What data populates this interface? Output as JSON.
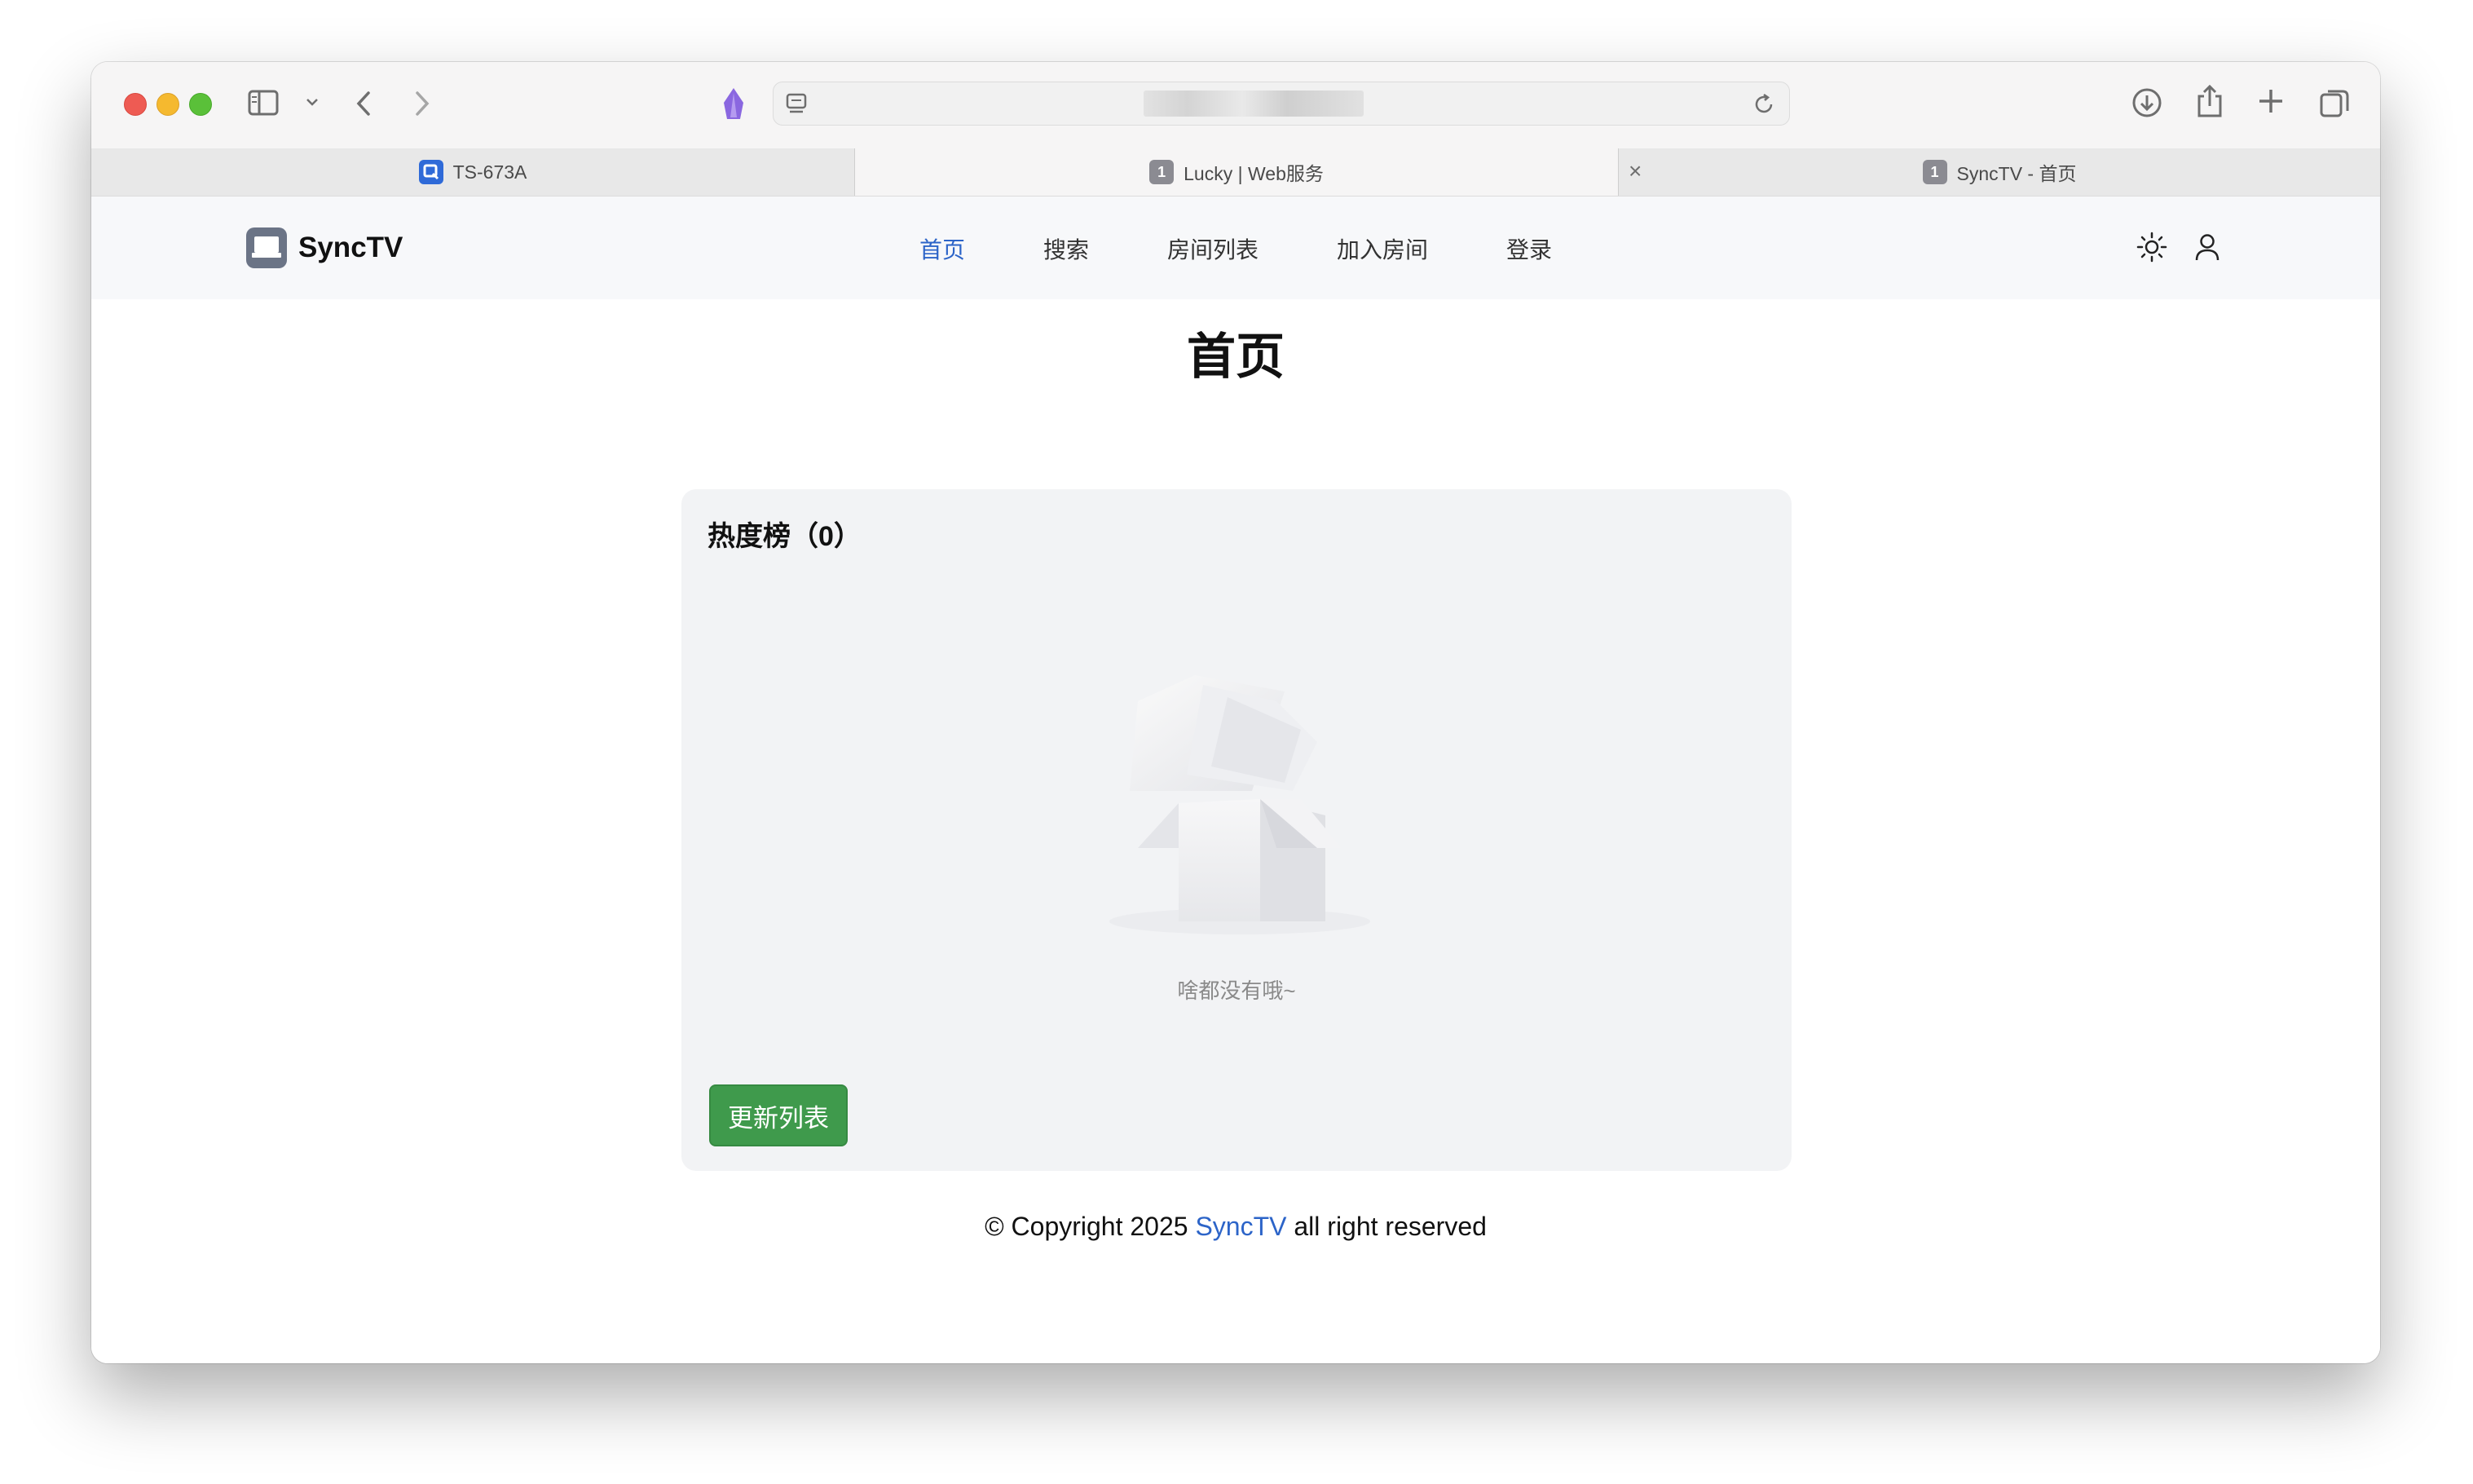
{
  "browser": {
    "tabs": [
      {
        "title": "TS-673A",
        "favicon": "qnap-icon",
        "active": false
      },
      {
        "title": "Lucky | Web服务",
        "favicon_badge": "1",
        "active": true
      },
      {
        "title": "SyncTV - 首页",
        "favicon_badge": "1",
        "active": false
      }
    ]
  },
  "site": {
    "logo_text": "SyncTV",
    "nav": [
      {
        "label": "首页",
        "active": true
      },
      {
        "label": "搜索"
      },
      {
        "label": "房间列表"
      },
      {
        "label": "加入房间"
      },
      {
        "label": "登录"
      }
    ],
    "page_title": "首页",
    "hot_list": {
      "title": "热度榜（0）",
      "empty_text": "啥都没有哦~",
      "refresh_label": "更新列表"
    },
    "footer": {
      "prefix": "© Copyright 2025 ",
      "brand": "SyncTV",
      "suffix": " all right reserved"
    }
  },
  "colors": {
    "accent": "#2c64c8",
    "button_green": "#3f9a4c",
    "card_bg": "#f2f3f5"
  }
}
